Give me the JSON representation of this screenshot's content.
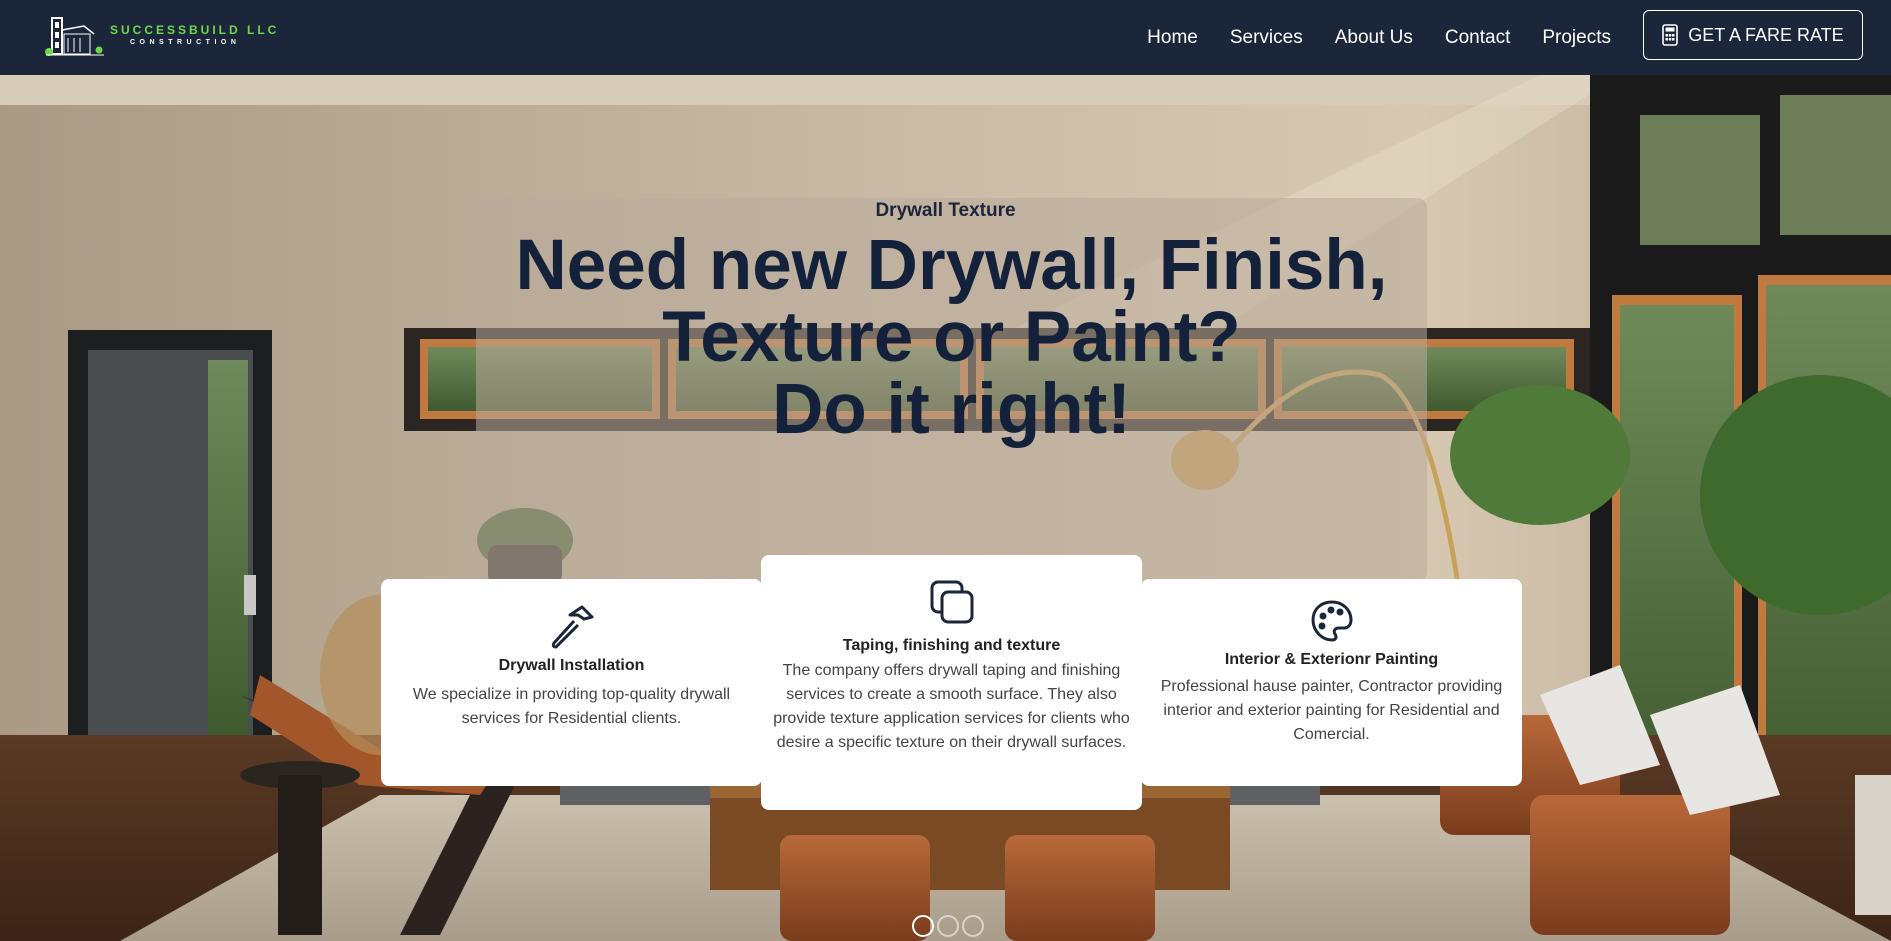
{
  "brand": {
    "name": "SUCCESSBUILD LLC",
    "tagline": "CONSTRUCTION",
    "colors": {
      "navy": "#1b263b",
      "accent_green": "#6fd84a",
      "white": "#ffffff"
    }
  },
  "nav": {
    "items": [
      {
        "label": "Home"
      },
      {
        "label": "Services"
      },
      {
        "label": "About Us"
      },
      {
        "label": "Contact"
      },
      {
        "label": "Projects"
      }
    ],
    "cta": {
      "label": "GET A FARE RATE",
      "icon": "calculator-icon"
    }
  },
  "hero": {
    "eyebrow": "Drywall Texture",
    "headline_lines": [
      "Need new Drywall, Finish,",
      "Texture or Paint?",
      "Do it right!"
    ],
    "background": "interior-living-room-photo"
  },
  "services": [
    {
      "icon": "hammer-icon",
      "title": "Drywall Installation",
      "text": "We specialize in providing top-quality drywall services for Residential clients."
    },
    {
      "icon": "layers-icon",
      "title": "Taping, finishing and texture",
      "text": "The company offers drywall taping and finishing services to create a smooth surface. They also provide texture application services for clients who desire a specific texture on their drywall surfaces."
    },
    {
      "icon": "palette-icon",
      "title": "Interior & Exterionr Painting",
      "text": "Professional hause painter, Contractor providing interior and exterior painting for Residential and Comercial."
    }
  ],
  "slider": {
    "count": 3,
    "active": 1
  }
}
